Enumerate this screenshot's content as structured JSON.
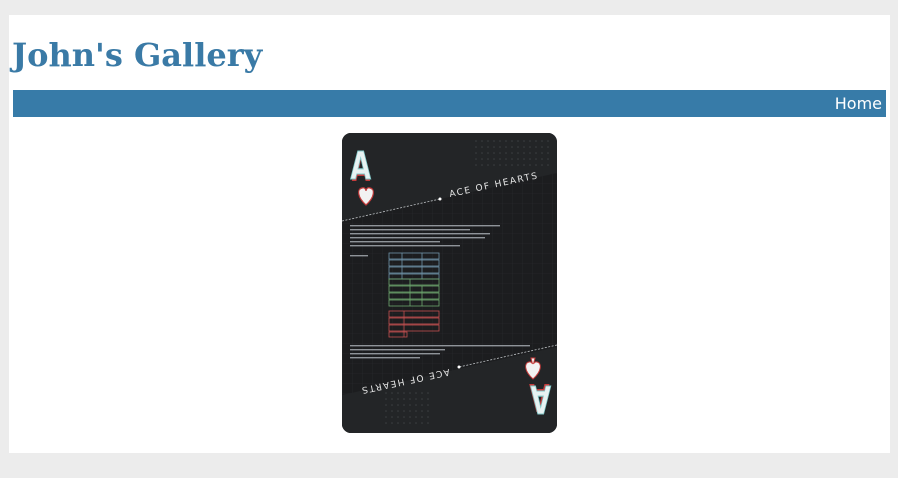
{
  "header": {
    "title": "John's Gallery"
  },
  "nav": {
    "items": [
      {
        "label": "Home"
      }
    ]
  },
  "gallery": {
    "card": {
      "rank": "A",
      "banner_text": "ACE OF HEARTS",
      "suit_top": "heart",
      "suit_bottom": "spade",
      "colors": {
        "background": "#1c1d1f",
        "rank_red": "#c43b3b",
        "rank_cyan": "#7fc8c8",
        "block_blue": "#6f93a8",
        "block_green": "#6fa86f",
        "block_red": "#c45050"
      }
    }
  }
}
